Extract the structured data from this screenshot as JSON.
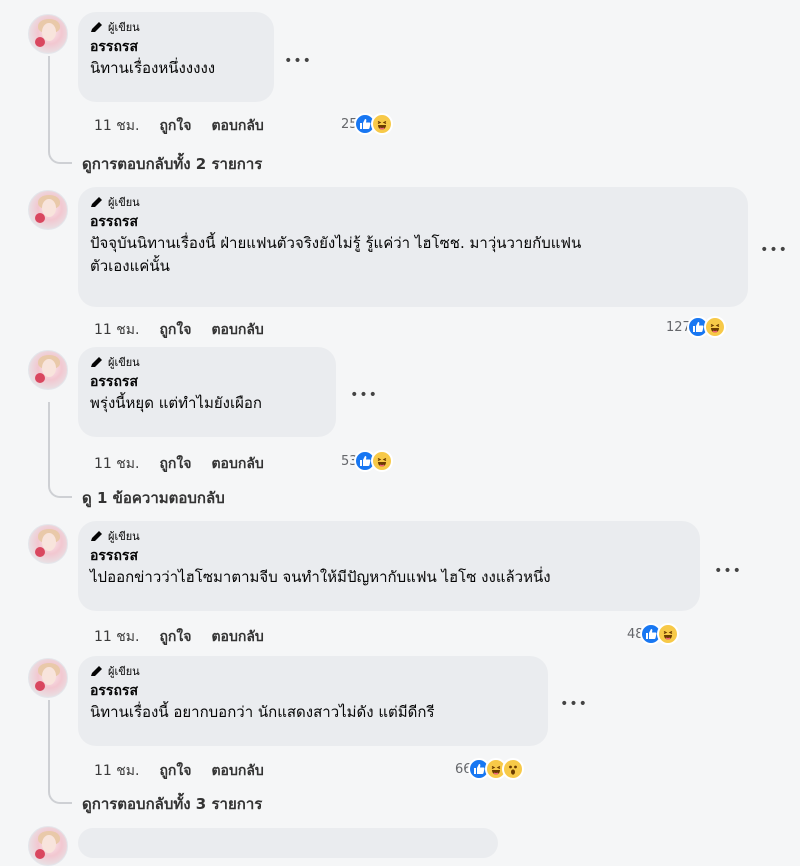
{
  "badge_label": "ผู้เขียน",
  "more_label": "•••",
  "comments": [
    {
      "author": "อรรถรส",
      "lines": [
        "นิทานเรื่องหนึ่งงงงง"
      ],
      "time": "11 ชม.",
      "like_label": "ถูกใจ",
      "reply_label": "ตอบกลับ",
      "reaction_count": "25",
      "reactions": [
        "like",
        "haha"
      ]
    },
    {
      "author": "อรรถรส",
      "lines": [
        "ปัจจุบันนิทานเรื่องนี้ ฝ่ายแฟนตัวจริงยังไม่รู้ รู้แค่ว่า ไฮโซช. มาวุ่นวายกับแฟน",
        "ตัวเองแค่นั้น"
      ],
      "time": "11 ชม.",
      "like_label": "ถูกใจ",
      "reply_label": "ตอบกลับ",
      "reaction_count": "127",
      "reactions": [
        "like",
        "haha"
      ]
    },
    {
      "author": "อรรถรส",
      "lines": [
        "พรุ่งนี้หยุด แต่ทำไมยังเผือก"
      ],
      "time": "11 ชม.",
      "like_label": "ถูกใจ",
      "reply_label": "ตอบกลับ",
      "reaction_count": "53",
      "reactions": [
        "like",
        "haha"
      ]
    },
    {
      "author": "อรรถรส",
      "lines": [
        "ไปออกข่าวว่าไฮโซมาตามจีบ จนทำให้มีปัญหากับแฟน ไฮโซ งงแล้วหนึ่ง"
      ],
      "time": "11 ชม.",
      "like_label": "ถูกใจ",
      "reply_label": "ตอบกลับ",
      "reaction_count": "48",
      "reactions": [
        "like",
        "haha"
      ]
    },
    {
      "author": "อรรถรส",
      "lines": [
        "นิทานเรื่องนี้ อยากบอกว่า นักแสดงสาวไม่ดัง แต่มีดีกรี"
      ],
      "time": "11 ชม.",
      "like_label": "ถูกใจ",
      "reply_label": "ตอบกลับ",
      "reaction_count": "66",
      "reactions": [
        "like",
        "haha",
        "wow"
      ]
    }
  ],
  "view_more": [
    "ดูการตอบกลับทั้ง 2 รายการ",
    "ดู 1 ข้อความตอบกลับ",
    "ดูการตอบกลับทั้ง 3 รายการ"
  ]
}
